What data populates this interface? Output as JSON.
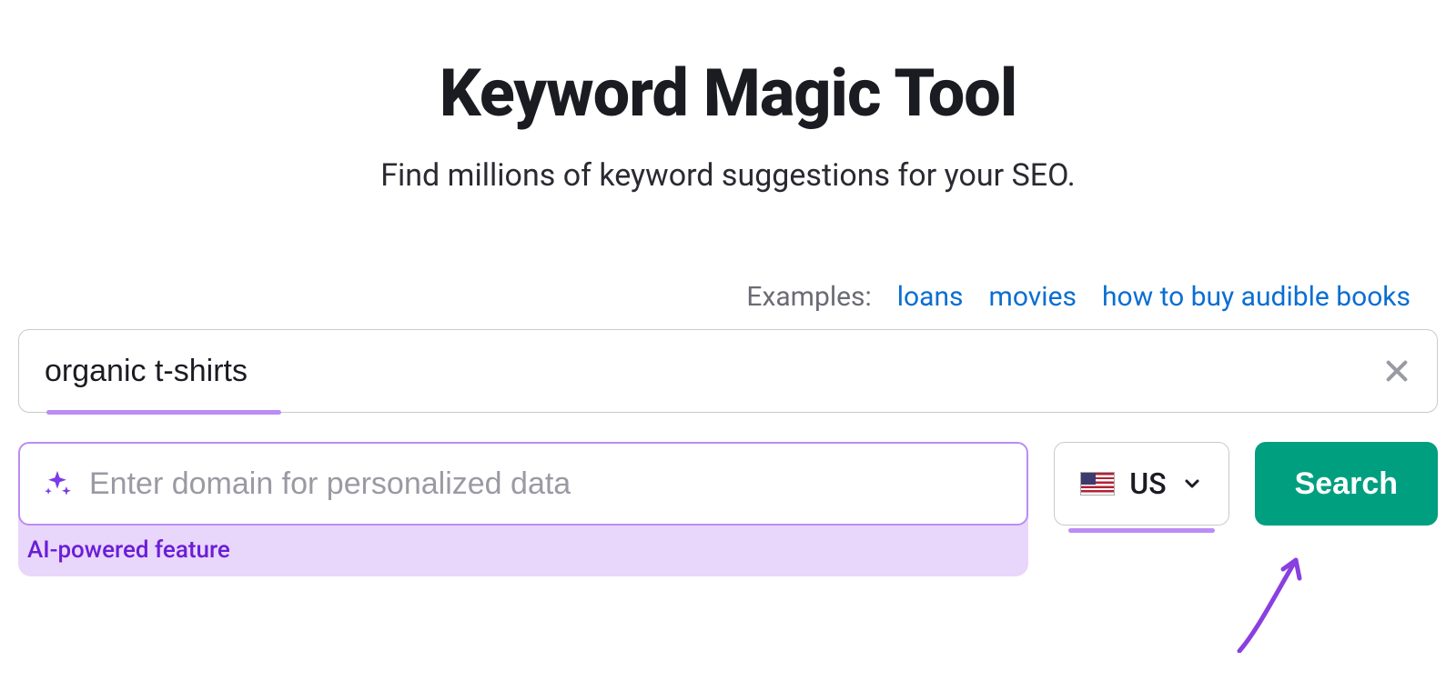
{
  "header": {
    "title": "Keyword Magic Tool",
    "subtitle": "Find millions of keyword suggestions for your SEO."
  },
  "examples": {
    "label": "Examples:",
    "links": [
      "loans",
      "movies",
      "how to buy audible books"
    ]
  },
  "keyword_input": {
    "value": "organic t-shirts"
  },
  "domain_input": {
    "placeholder": "Enter domain for personalized data",
    "ai_label": "AI-powered feature"
  },
  "country": {
    "code": "US"
  },
  "search": {
    "label": "Search"
  }
}
